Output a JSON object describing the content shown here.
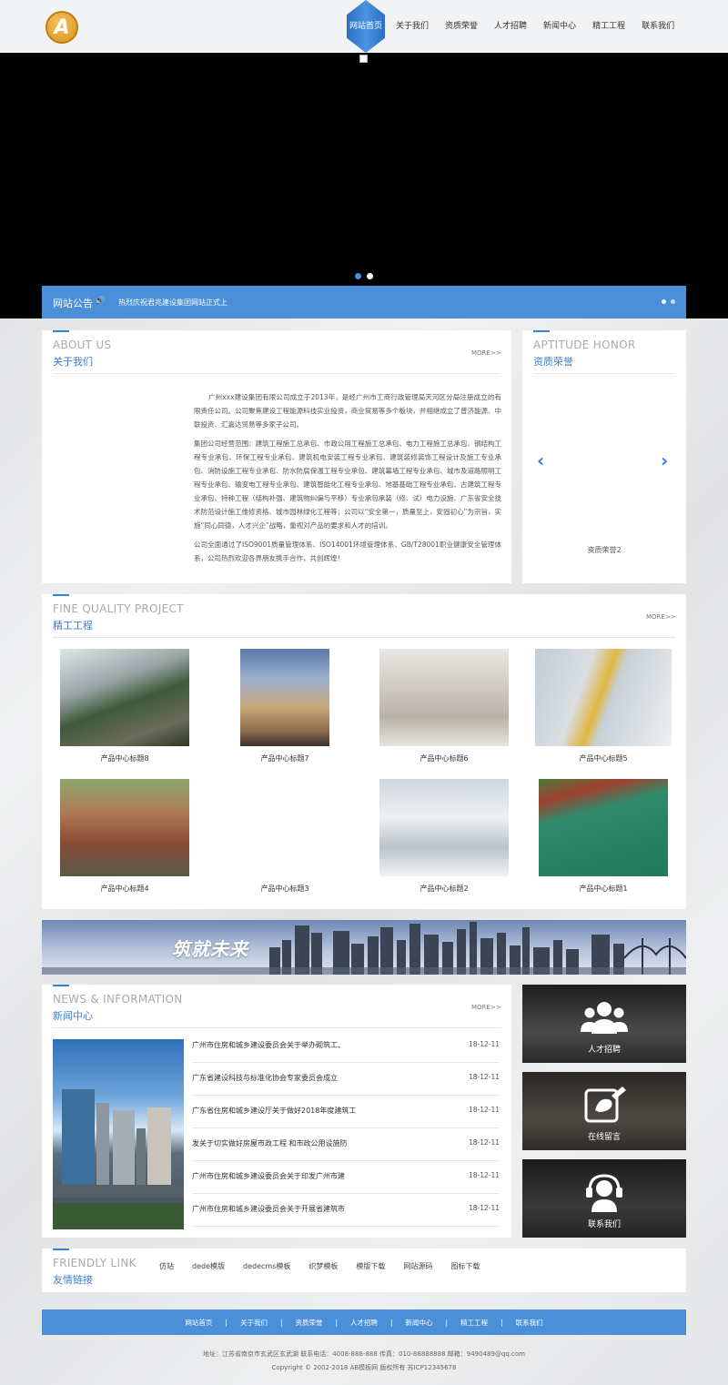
{
  "header": {
    "logo_letter": "A",
    "nav": [
      "网站首页",
      "关于我们",
      "资质荣誉",
      "人才招聘",
      "新闻中心",
      "精工工程",
      "联系我们"
    ]
  },
  "banner": {
    "slide_count": 2,
    "active_slide": 1
  },
  "notice": {
    "title": "网站公告",
    "text": "热烈庆祝君兆建设集团网站正式上"
  },
  "about": {
    "title_en": "ABOUT US",
    "title_cn": "关于我们",
    "more": "MORE>>",
    "paragraphs": [
      "广州xxx建设集团有限公司成立于2013年，是经广州市工商行政管理局天河区分局注册成立的有限责任公司。公司聚焦建设工程能源科技实业投资，商业贸易等多个板块，并相继成立了普济能源、中联投资、汇嘉达贸易等多家子公司。",
      "集团公司经营范围：建筑工程施工总承包、市政公用工程施工总承包、电力工程施工总承包、钢结构工程专业承包、环保工程专业承包、建筑机电安装工程专业承包、建筑装修装饰工程设计及施工专业承包、消防设施工程专业承包、防水防腐保温工程专业承包、建筑幕墙工程专业承包、城市及道路照明工程专业承包、输变电工程专业承包、建筑智能化工程专业承包、地基基础工程专业承包、古建筑工程专业承包、特种工程（结构补强、建筑物纠偏与平移）专业承包承装（修、试）电力设施、广东省安全技术防范设计施工维修资格、城市园林绿化工程等；公司以“安全第一，质量至上，安固初心”为宗旨，实施“同心同德，人才兴企”战略，重视对产品的要求和人才的培训。",
      "公司全面通过了ISO9001质量管理体系、ISO14001环境管理体系、GB/T28001职业健康安全管理体系，公司热烈欢迎各界朋友携手合作，共创辉煌！"
    ]
  },
  "honor": {
    "title_en": "APTITUDE HONOR",
    "title_cn": "资质荣誉",
    "caption": "资质荣誉2",
    "prev": "‹",
    "next": "›"
  },
  "projects": {
    "title_en": "FINE QUALITY PROJECT",
    "title_cn": "精工工程",
    "more": "MORE>>",
    "items": [
      "产品中心标题8",
      "产品中心标题7",
      "产品中心标题6",
      "产品中心标题5",
      "产品中心标题4",
      "产品中心标题3",
      "产品中心标题2",
      "产品中心标题1"
    ]
  },
  "city_banner": {
    "text": "筑就未来"
  },
  "news": {
    "title_en": "NEWS & INFORMATION",
    "title_cn": "新闻中心",
    "more": "MORE>>",
    "items": [
      {
        "title": "广州市住房和城乡建设委员会关于举办砌筑工、",
        "date": "18-12-11"
      },
      {
        "title": "广东省建设科技与标准化协会专家委员会成立",
        "date": "18-12-11"
      },
      {
        "title": "广东省住房和城乡建设厅关于做好2018年度建筑工",
        "date": "18-12-11"
      },
      {
        "title": "发关于切实做好房屋市政工程 和市政公用设施防",
        "date": "18-12-11"
      },
      {
        "title": "广州市住房和城乡建设委员会关于印发广州市建",
        "date": "18-12-11"
      },
      {
        "title": "广州市住房和城乡建设委员会关于开展省建筑市",
        "date": "18-12-11"
      }
    ]
  },
  "side_links": [
    {
      "label": "人才招聘",
      "icon": "people-icon"
    },
    {
      "label": "在线留言",
      "icon": "message-icon"
    },
    {
      "label": "联系我们",
      "icon": "headset-icon"
    }
  ],
  "friendly": {
    "title_en": "FRIENDLY LINK",
    "title_cn": "友情链接",
    "links": [
      "仿站",
      "dede模版",
      "dedecms模板",
      "织梦模板",
      "模版下载",
      "网站源码",
      "图标下载"
    ]
  },
  "footer": {
    "nav": [
      "网站首页",
      "关于我们",
      "资质荣誉",
      "人才招聘",
      "新闻中心",
      "精工工程",
      "联系我们"
    ],
    "separator": "|",
    "address": "地址：江苏省南京市玄武区玄武湖  联系电话：4008-888-888  传真：010-88888888  邮箱：9490489@qq.com",
    "copyright": "Copyright © 2002-2018 AB模板网 版权所有    苏ICP12345678"
  },
  "colors": {
    "accent": "#4a8fd8",
    "title_blue": "#3a7fd0",
    "banner_bg": "#000000"
  }
}
